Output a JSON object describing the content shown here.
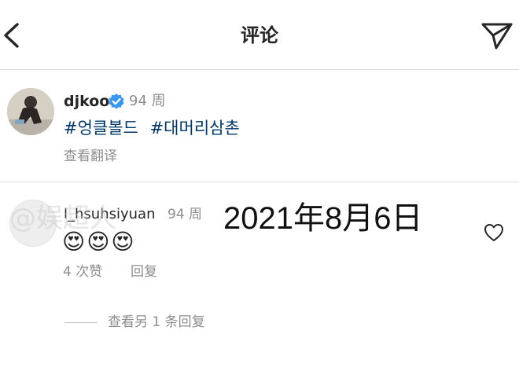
{
  "header": {
    "title": "评论",
    "back_icon": "chevron-left-icon",
    "share_icon": "paper-plane-icon"
  },
  "post": {
    "username": "djkoo",
    "verified_icon": "verified-badge-icon",
    "time": "94 周",
    "hashtags": [
      "#엉클볼드",
      "#대머리삼촌"
    ],
    "translate_label": "查看翻译"
  },
  "comment": {
    "username": "l_hsuhsiyuan",
    "time": "94 周",
    "text": "😍😍😍",
    "likes": "4 次赞",
    "reply_label": "回复",
    "view_replies_label": "查看另 1 条回复",
    "like_icon": "heart-outline-icon"
  },
  "overlay": {
    "date_text": "2021年8月6日",
    "watermark_text": "@娱超人"
  },
  "colors": {
    "hashtag": "#00376b",
    "secondary_text": "#8e8e8e",
    "verified": "#3897f0",
    "divider": "#dbdbdb"
  }
}
